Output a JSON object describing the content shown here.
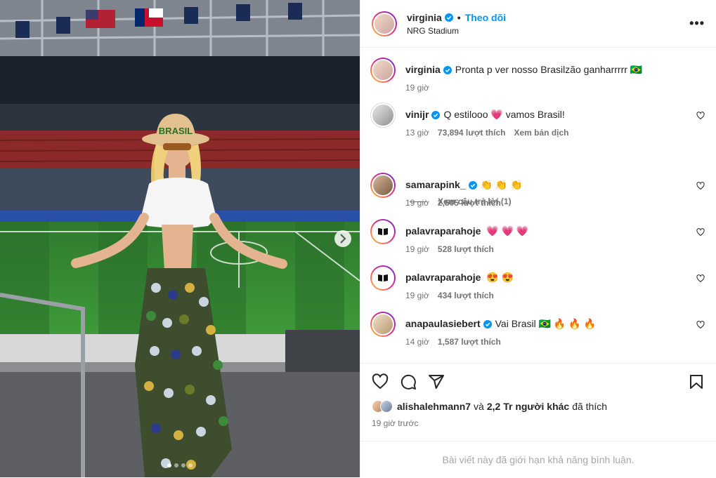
{
  "post": {
    "author": "virginia",
    "follow_label": "Theo dõi",
    "separator": "•",
    "location": "NRG Stadium",
    "more": "•••"
  },
  "photo": {
    "hat_text": "BRASIL",
    "slides": 4,
    "active_slide": 0
  },
  "caption": {
    "username": "virginia",
    "text": "Pronta p ver nosso Brasilzão ganharrrrr 🇧🇷",
    "time": "19 giờ"
  },
  "comments": [
    {
      "username": "vinijr",
      "verified": true,
      "text": "Q estilooo 💗 vamos Brasil!",
      "time": "13 giờ",
      "likes": "73,894 lượt thích",
      "extra": "Xem bản dịch",
      "replies": "Xem câu trả lời (1)"
    },
    {
      "username": "samarapink_",
      "verified": true,
      "text": "👏 👏 👏",
      "time": "19 giờ",
      "likes": "2,505 lượt thích"
    },
    {
      "username": "palavraparahoje",
      "verified": false,
      "text": "💗 💗 💗",
      "time": "19 giờ",
      "likes": "528 lượt thích"
    },
    {
      "username": "palavraparahoje",
      "verified": false,
      "text": "😍 😍",
      "time": "19 giờ",
      "likes": "434 lượt thích"
    },
    {
      "username": "anapaulasiebert",
      "verified": true,
      "text": "Vai Brasil 🇧🇷 🔥 🔥 🔥",
      "time": "14 giờ",
      "likes": "1,587 lượt thích"
    }
  ],
  "liked_by": {
    "username": "alishalehmann7",
    "connector": "và",
    "others": "2,2 Tr người khác",
    "suffix": "đã thích"
  },
  "posted_time": "19 giờ trước",
  "comments_limited": "Bài viết này đã giới hạn khả năng bình luận.",
  "colors": {
    "accent": "#0095f6",
    "verified": "#0095f6",
    "muted": "#737373"
  }
}
